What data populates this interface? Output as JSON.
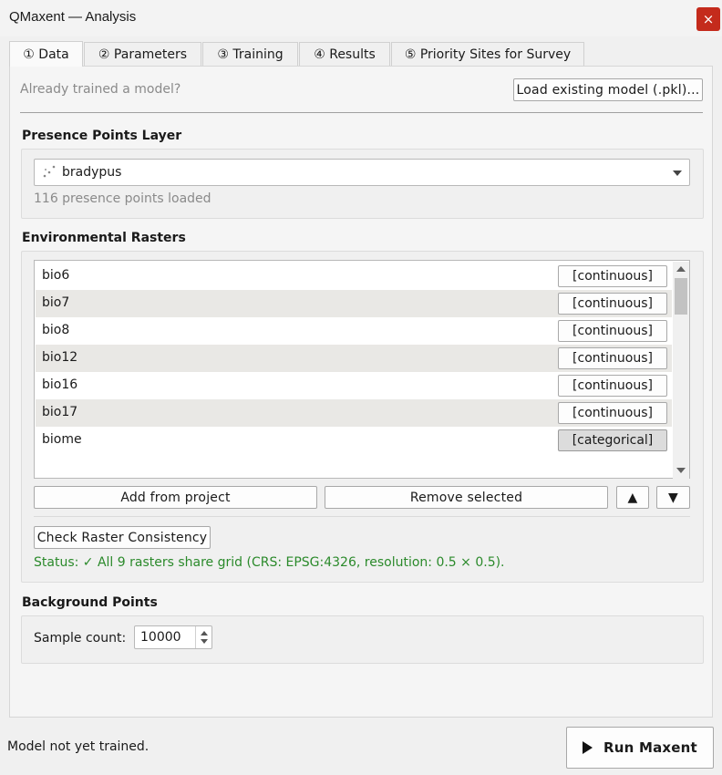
{
  "window": {
    "title": "QMaxent — Analysis",
    "close_label": "×"
  },
  "tabs": [
    {
      "label": "① Data"
    },
    {
      "label": "② Parameters"
    },
    {
      "label": "③ Training"
    },
    {
      "label": "④ Results"
    },
    {
      "label": "⑤ Priority Sites for Survey"
    }
  ],
  "load_model": {
    "prompt": "Already trained a model?",
    "button_label": "Load existing model (.pkl)..."
  },
  "presence": {
    "section_title": "Presence Points Layer",
    "layer_name": "bradypus",
    "info": "116 presence points loaded"
  },
  "rasters": {
    "section_title": "Environmental Rasters",
    "items": [
      {
        "name": "bio6",
        "type": "[continuous]"
      },
      {
        "name": "bio7",
        "type": "[continuous]"
      },
      {
        "name": "bio8",
        "type": "[continuous]"
      },
      {
        "name": "bio12",
        "type": "[continuous]"
      },
      {
        "name": "bio16",
        "type": "[continuous]"
      },
      {
        "name": "bio17",
        "type": "[continuous]"
      },
      {
        "name": "biome",
        "type": "[categorical]"
      }
    ],
    "add_label": "Add from project",
    "remove_label": "Remove selected",
    "move_up_label": "▲",
    "move_down_label": "▼",
    "check_label": "Check Raster Consistency",
    "status": "Status: ✓ All 9 rasters share grid (CRS: EPSG:4326, resolution: 0.5 × 0.5)."
  },
  "background": {
    "section_title": "Background Points",
    "sample_label": "Sample count:",
    "sample_value": "10000"
  },
  "footer": {
    "status": "Model not yet trained.",
    "run_label": "Run Maxent"
  },
  "colors": {
    "status_green": "#2b8a2b",
    "close_red": "#c42b1c",
    "alt_row": "#e9e8e5"
  }
}
